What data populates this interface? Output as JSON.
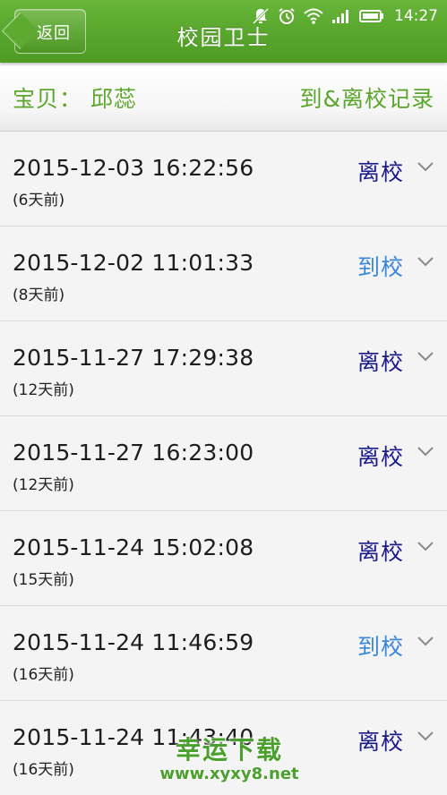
{
  "status_bar": {
    "time": "14:27",
    "icons": [
      "notification-off-icon",
      "alarm-icon",
      "wifi-icon",
      "signal-icon",
      "battery-icon"
    ]
  },
  "header": {
    "back_label": "返回",
    "title": "校园卫士"
  },
  "subheader": {
    "child_name": "宝贝： 邱蕊",
    "records_link": "到&离校记录"
  },
  "records": [
    {
      "datetime": "2015-12-03 16:22:56",
      "ago": "(6天前)",
      "status": "离校",
      "type": "leave"
    },
    {
      "datetime": "2015-12-02 11:01:33",
      "ago": "(8天前)",
      "status": "到校",
      "type": "arrive"
    },
    {
      "datetime": "2015-11-27 17:29:38",
      "ago": "(12天前)",
      "status": "离校",
      "type": "leave"
    },
    {
      "datetime": "2015-11-27 16:23:00",
      "ago": "(12天前)",
      "status": "离校",
      "type": "leave"
    },
    {
      "datetime": "2015-11-24 15:02:08",
      "ago": "(15天前)",
      "status": "离校",
      "type": "leave"
    },
    {
      "datetime": "2015-11-24 11:46:59",
      "ago": "(16天前)",
      "status": "到校",
      "type": "arrive"
    },
    {
      "datetime": "2015-11-24 11:43:40",
      "ago": "(16天前)",
      "status": "离校",
      "type": "leave"
    }
  ],
  "colors": {
    "header_green": "#5aa82e",
    "accent_green": "#5aa62a",
    "leave_color": "#1a1a8c",
    "arrive_color": "#3a86d8"
  },
  "watermark": {
    "line1": "幸运下载",
    "line2": "www.xyxy8.net"
  }
}
